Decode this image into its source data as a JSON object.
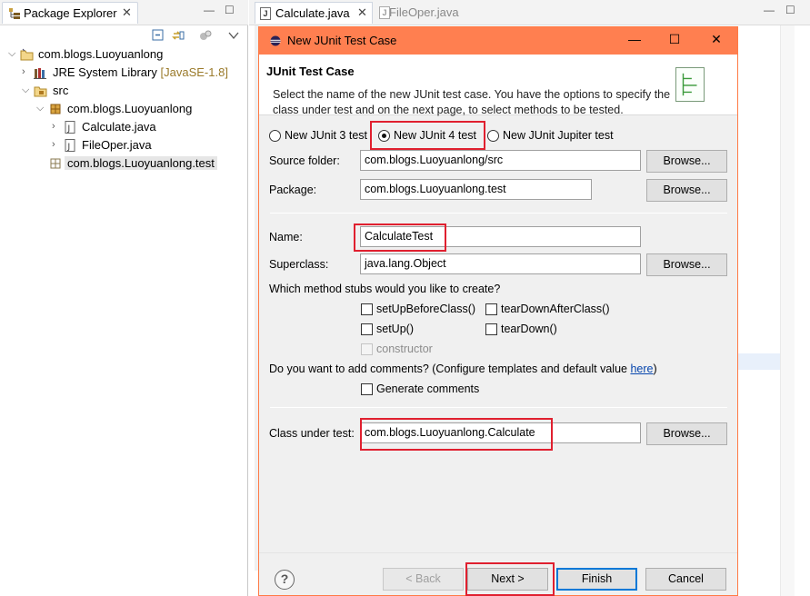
{
  "explorer": {
    "tab_title": "Package Explorer",
    "close_glyph": "✕",
    "minimize_glyph": "—",
    "maximize_glyph": "☐",
    "tree": [
      {
        "label": "com.blogs.Luoyuanlong",
        "suffix": "",
        "icon": "project-icon",
        "arrow": "⌵",
        "level": 0
      },
      {
        "label": "JRE System Library",
        "suffix": "[JavaSE-1.8]",
        "icon": "library-icon",
        "arrow": "›",
        "level": 1
      },
      {
        "label": "src",
        "suffix": "",
        "icon": "source-folder-icon",
        "arrow": "⌵",
        "level": 1
      },
      {
        "label": "com.blogs.Luoyuanlong",
        "suffix": "",
        "icon": "package-icon",
        "arrow": "⌵",
        "level": 2
      },
      {
        "label": "Calculate.java",
        "suffix": "",
        "icon": "java-file-icon",
        "arrow": "›",
        "level": 3
      },
      {
        "label": "FileOper.java",
        "suffix": "",
        "icon": "java-file-icon",
        "arrow": "›",
        "level": 3
      },
      {
        "label": "com.blogs.Luoyuanlong.test",
        "suffix": "",
        "icon": "package-icon",
        "arrow": "",
        "level": 2,
        "selected": true
      }
    ]
  },
  "editor": {
    "tabs": [
      {
        "label": "Calculate.java",
        "close": "✕",
        "active": true
      },
      {
        "label": "FileOper.java",
        "active": false
      }
    ],
    "minimize_glyph": "—",
    "maximize_glyph": "☐"
  },
  "dialog": {
    "title": "New JUnit Test Case",
    "min_glyph": "—",
    "max_glyph": "☐",
    "close_glyph": "✕",
    "heading": "JUnit Test Case",
    "description": "Select the name of the new JUnit test case. You have the options to specify the class under test and on the next page, to select methods to be tested.",
    "junit_options": [
      {
        "label": "New JUnit 3 test",
        "selected": false
      },
      {
        "label": "New JUnit 4 test",
        "selected": true
      },
      {
        "label": "New JUnit Jupiter test",
        "selected": false
      }
    ],
    "source_folder_label": "Source folder:",
    "source_folder_value": "com.blogs.Luoyuanlong/src",
    "package_label": "Package:",
    "package_value": "com.blogs.Luoyuanlong.test",
    "name_label": "Name:",
    "name_value": "CalculateTest",
    "superclass_label": "Superclass:",
    "superclass_value": "java.lang.Object",
    "stubs_question": "Which method stubs would you like to create?",
    "stubs": {
      "setup_before_class": "setUpBeforeClass()",
      "teardown_after_class": "tearDownAfterClass()",
      "setup": "setUp()",
      "teardown": "tearDown()",
      "constructor": "constructor"
    },
    "comments_question_prefix": "Do you want to add comments? (Configure templates and default value ",
    "comments_link": "here",
    "comments_question_suffix": ")",
    "generate_comments_label": "Generate comments",
    "class_under_test_label": "Class under test:",
    "class_under_test_value": "com.blogs.Luoyuanlong.Calculate",
    "browse_label": "Browse...",
    "help_glyph": "?",
    "buttons": {
      "back": "< Back",
      "next": "Next >",
      "finish": "Finish",
      "cancel": "Cancel"
    }
  },
  "colors": {
    "titlebar": "#ff7f50",
    "highlight_box": "#e0202f",
    "default_button_border": "#0078d7"
  }
}
